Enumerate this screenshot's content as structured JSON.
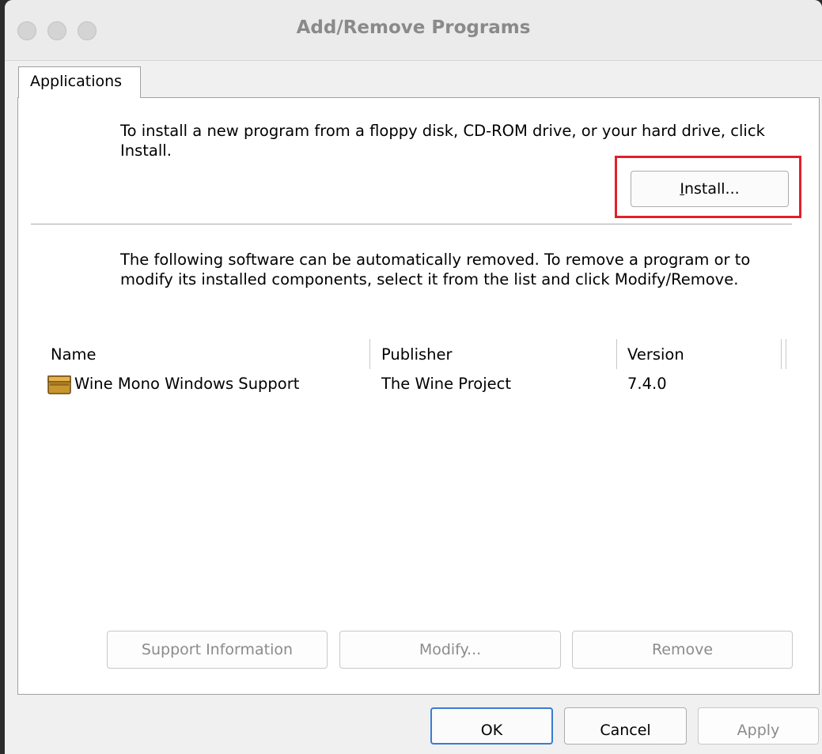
{
  "window": {
    "title": "Add/Remove Programs"
  },
  "tabs": [
    {
      "label": "Applications"
    }
  ],
  "install_section": {
    "description": "To install a new program from a floppy disk, CD-ROM drive, or your hard drive, click Install.",
    "install_button": {
      "label": "Install...",
      "mnemonic": "I"
    }
  },
  "remove_section": {
    "description": "The following software can be automatically removed. To remove a program or to modify its installed components, select it from the list and click Modify/Remove."
  },
  "programs_table": {
    "columns": [
      "Name",
      "Publisher",
      "Version"
    ],
    "rows": [
      {
        "name": "Wine Mono Windows Support",
        "publisher": "The Wine Project",
        "version": "7.4.0",
        "icon": "package-icon"
      }
    ]
  },
  "action_buttons": {
    "support_info": "Support Information",
    "modify": "Modify...",
    "remove": "Remove"
  },
  "dialog_buttons": {
    "ok": "OK",
    "cancel": "Cancel",
    "apply": "Apply"
  },
  "colors": {
    "highlight": "#e0202c",
    "disabled_text": "#8b8b8b"
  }
}
